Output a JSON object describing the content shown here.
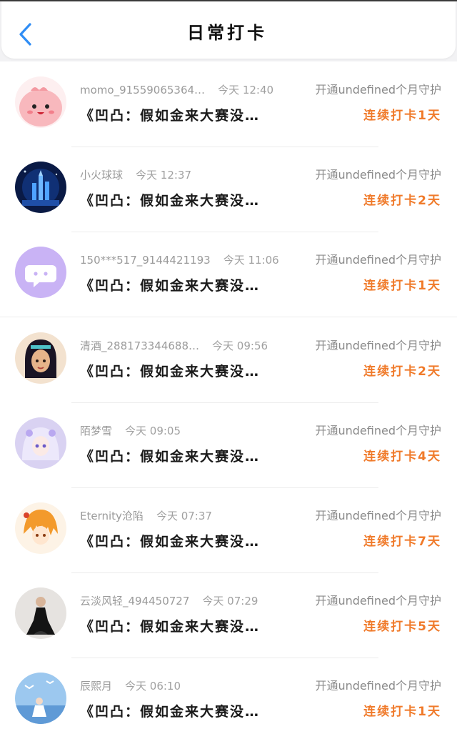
{
  "header": {
    "title": "日常打卡",
    "back_icon": "chevron-left-icon",
    "accent": "#2f8df5"
  },
  "colors": {
    "streak": "#f07a2a",
    "meta": "#9a9a9a"
  },
  "records": [
    {
      "name": "momo_91559065364…",
      "time": "今天 12:40",
      "guard": "开通undefined个月守护",
      "book": "《凹凸：假如金来大赛没…",
      "streak": "连续打卡1天",
      "avatar_icon": "pink-cartoon-avatar"
    },
    {
      "name": "小火球球",
      "time": "今天 12:37",
      "guard": "开通undefined个月守护",
      "book": "《凹凸：假如金来大赛没…",
      "streak": "连续打卡2天",
      "avatar_icon": "night-castle-avatar"
    },
    {
      "name": "150***517_9144421193",
      "time": "今天 11:06",
      "guard": "开通undefined个月守护",
      "book": "《凹凸：假如金来大赛没…",
      "streak": "连续打卡1天",
      "avatar_icon": "default-chat-avatar"
    },
    {
      "name": "清酒_288173344688…",
      "time": "今天 09:56",
      "guard": "开通undefined个月守护",
      "book": "《凹凸：假如金来大赛没…",
      "streak": "连续打卡2天",
      "avatar_icon": "princess-avatar"
    },
    {
      "name": "陌梦雪",
      "time": "今天 09:05",
      "guard": "开通undefined个月守护",
      "book": "《凹凸：假如金来大赛没…",
      "streak": "连续打卡4天",
      "avatar_icon": "anime-girl-avatar"
    },
    {
      "name": "Eternity沧陷",
      "time": "今天 07:37",
      "guard": "开通undefined个月守护",
      "book": "《凹凸：假如金来大赛没…",
      "streak": "连续打卡7天",
      "avatar_icon": "orange-hair-avatar"
    },
    {
      "name": "云淡风轻_494450727",
      "time": "今天 07:29",
      "guard": "开通undefined个月守护",
      "book": "《凹凸：假如金来大赛没…",
      "streak": "连续打卡5天",
      "avatar_icon": "black-dress-avatar"
    },
    {
      "name": "辰熙月",
      "time": "今天 06:10",
      "guard": "开通undefined个月守护",
      "book": "《凹凸：假如金来大赛没…",
      "streak": "连续打卡1天",
      "avatar_icon": "sky-birds-avatar"
    }
  ]
}
